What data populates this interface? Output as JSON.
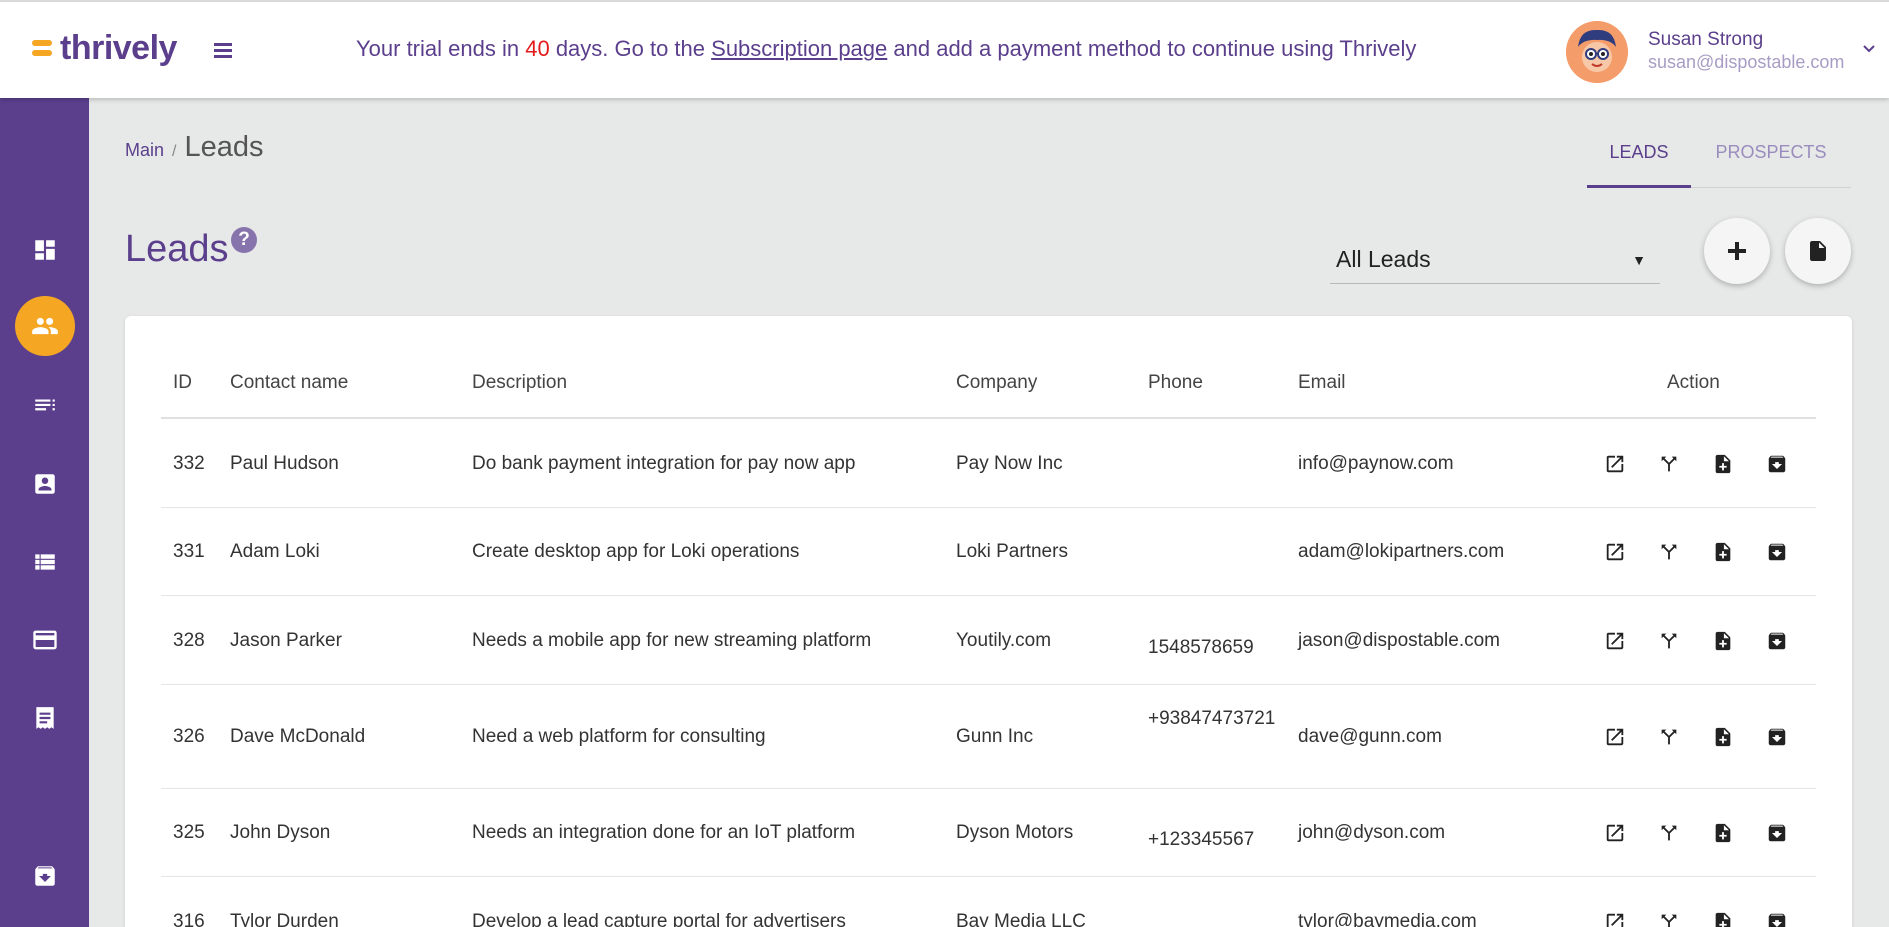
{
  "app": {
    "logo_text": "thrively",
    "brand_color": "#5b3f8c",
    "accent_color": "#f5a623"
  },
  "trial": {
    "prefix": "Your trial ends in",
    "days": "40",
    "middle": "days. Go to the",
    "link_text": "Subscription page",
    "suffix": "and add a payment method to continue using Thrively"
  },
  "user": {
    "name": "Susan Strong",
    "email": "susan@dispostable.com"
  },
  "sidebar": {
    "items": [
      {
        "icon": "dashboard-icon"
      },
      {
        "icon": "people-icon",
        "active": true
      },
      {
        "icon": "list-icon"
      },
      {
        "icon": "contact-card-icon"
      },
      {
        "icon": "table-list-icon"
      },
      {
        "icon": "credit-card-icon"
      },
      {
        "icon": "receipt-icon"
      },
      {
        "icon": "archive-icon"
      }
    ]
  },
  "breadcrumb": {
    "main": "Main",
    "separator": "/",
    "current": "Leads"
  },
  "tabs": {
    "leads": "LEADS",
    "prospects": "PROSPECTS"
  },
  "page": {
    "title": "Leads",
    "help": "?"
  },
  "filter": {
    "selected": "All Leads",
    "arrow": "▼"
  },
  "table": {
    "headers": {
      "id": "ID",
      "contact": "Contact name",
      "description": "Description",
      "company": "Company",
      "phone": "Phone",
      "email": "Email",
      "action": "Action"
    },
    "rows": [
      {
        "id": "332",
        "contact": "Paul Hudson",
        "description": "Do bank payment integration for pay now app",
        "company": "Pay Now Inc",
        "phone": "",
        "email": "info@paynow.com"
      },
      {
        "id": "331",
        "contact": "Adam Loki",
        "description": "Create desktop app for Loki operations",
        "company": "Loki Partners",
        "phone": "",
        "email": "adam@lokipartners.com"
      },
      {
        "id": "328",
        "contact": "Jason Parker",
        "description": "Needs a mobile app for new streaming platform",
        "company": "Youtily.com",
        "phone": "1548578659",
        "email": "jason@dispostable.com"
      },
      {
        "id": "326",
        "contact": "Dave McDonald",
        "description": "Need a web platform for consulting",
        "company": "Gunn Inc",
        "phone": "+93847473721",
        "email": "dave@gunn.com"
      },
      {
        "id": "325",
        "contact": "John Dyson",
        "description": "Needs an integration done for an IoT platform",
        "company": "Dyson Motors",
        "phone": "+123345567",
        "email": "john@dyson.com"
      },
      {
        "id": "316",
        "contact": "Tylor Durden",
        "description": "Develop a lead capture portal for advertisers",
        "company": "Bay Media LLC",
        "phone": "",
        "email": "tylor@baymedia.com"
      }
    ]
  }
}
